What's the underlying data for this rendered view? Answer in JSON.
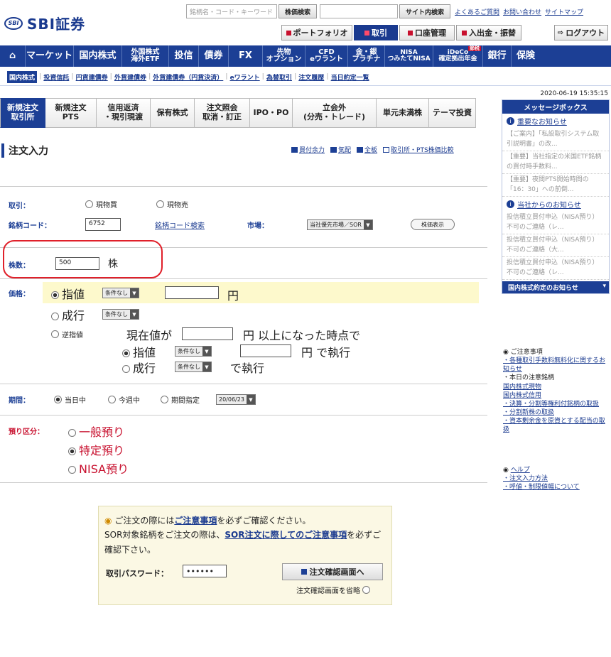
{
  "header": {
    "logo_mark": "SBI",
    "logo_text": "SBI証券",
    "search_placeholder": "銘柄名・コード・キーワード",
    "stock_search": "株価検索",
    "site_search": "サイト内検索",
    "links": [
      "よくあるご質問",
      "お問い合わせ",
      "サイトマップ"
    ],
    "tabs": [
      "ポートフォリオ",
      "取引",
      "口座管理",
      "入出金・振替"
    ],
    "logout": "ログアウト"
  },
  "mainnav": [
    {
      "label": "",
      "icon": "home-icon"
    },
    {
      "label": "マーケット"
    },
    {
      "label": "国内株式"
    },
    {
      "label": "外国株式\n海外ETF"
    },
    {
      "label": "投信"
    },
    {
      "label": "債券"
    },
    {
      "label": "FX"
    },
    {
      "label": "先物\nオプション"
    },
    {
      "label": "CFD\neワラント"
    },
    {
      "label": "金・銀\nプラチナ"
    },
    {
      "label": "NISA\nつみたてNISA"
    },
    {
      "label": "iDeCo\n確定拠出年金"
    },
    {
      "label": "銀行"
    },
    {
      "label": "保険"
    }
  ],
  "ideco_badge": "節税",
  "subnav": [
    "国内株式",
    "投資信託",
    "円貨建債券",
    "外貨建債券",
    "外貨建債券（円貨決済）",
    "eワラント",
    "為替取引",
    "注文履歴",
    "当日約定一覧"
  ],
  "timestamp": "2020-06-19 15:35:15",
  "order_tabs": [
    "新規注文\n取引所",
    "新規注文\nPTS",
    "信用返済\n・現引現渡",
    "保有株式",
    "注文照会\n取消・訂正",
    "IPO・PO",
    "立会外\n(分売・トレード)",
    "単元未満株",
    "テーマ投資"
  ],
  "page_title": "注文入力",
  "title_links": [
    "買付余力",
    "気配",
    "全板",
    "取引所・PTS株価比較"
  ],
  "form": {
    "trade_label": "取引：",
    "buy": "現物買",
    "sell": "現物売",
    "code_label": "銘柄コード：",
    "code_value": "6752",
    "code_search": "銘柄コード検索",
    "market_label": "市場：",
    "market_value": "当社優先市場／SOR",
    "price_button": "株価表示",
    "qty_label": "株数：",
    "qty_value": "500",
    "qty_unit": "株",
    "price_label": "価格：",
    "limit": "指値",
    "market_order": "成行",
    "stop": "逆指値",
    "cond": "条件なし",
    "yen": "円",
    "stop_text1": "現在値が",
    "stop_text2": "円 以上になった時点で",
    "stop_limit": "指値",
    "stop_exec": "円 で執行",
    "stop_market": "成行",
    "stop_market_exec": "で執行",
    "period_label": "期間：",
    "today": "当日中",
    "this_week": "今週中",
    "period_specify": "期間指定",
    "period_date": "20/06/23",
    "account_label": "預り区分：",
    "general": "一般預り",
    "specific": "特定預り",
    "nisa": "NISA預り"
  },
  "confirm": {
    "line1_pre": "ご注文の際には",
    "line1_link": "ご注意事項",
    "line1_post": "を必ずご確認ください。",
    "line2_pre": "SOR対象銘柄をご注文の際は、",
    "line2_link": "SOR注文に際してのご注意事項",
    "line2_post": "を必ずご確認下さい。",
    "pw_label": "取引パスワード：",
    "pw_value": "••••••",
    "submit": "注文確認画面へ",
    "skip": "注文確認画面を省略"
  },
  "sidebar": {
    "head": "メッセージボックス",
    "important": "重要なお知らせ",
    "news1": [
      "【ご案内】「私設取引システム取引説明書」の改...",
      "【重要】当社指定の米国ETF銘柄の買付時手数料...",
      "【重要】夜間PTS開始時間の「16：30」への前倒..."
    ],
    "from_us": "当社からのお知らせ",
    "news2": [
      "投信積立買付申込（NISA預り）不可のご連絡（レ...",
      "投信積立買付申込（NISA預り）不可のご連絡（大...",
      "投信積立買付申込（NISA預り）不可のご連絡（レ..."
    ],
    "contract": "国内株式約定のお知らせ",
    "notice_head": "ご注意事項",
    "notice_items": [
      "・各種取引手数料無料化に関するお知らせ",
      "・本日の注意銘柄",
      "国内株式現物",
      "国内株式信用",
      "・決算・分割等権利付銘柄の取扱",
      "・分割新株の取扱",
      "・資本剰余金を原資とする配当の取扱"
    ],
    "help_head": "ヘルプ",
    "help_items": [
      "・注文入力方法",
      "・呼値・制限値幅について"
    ]
  }
}
